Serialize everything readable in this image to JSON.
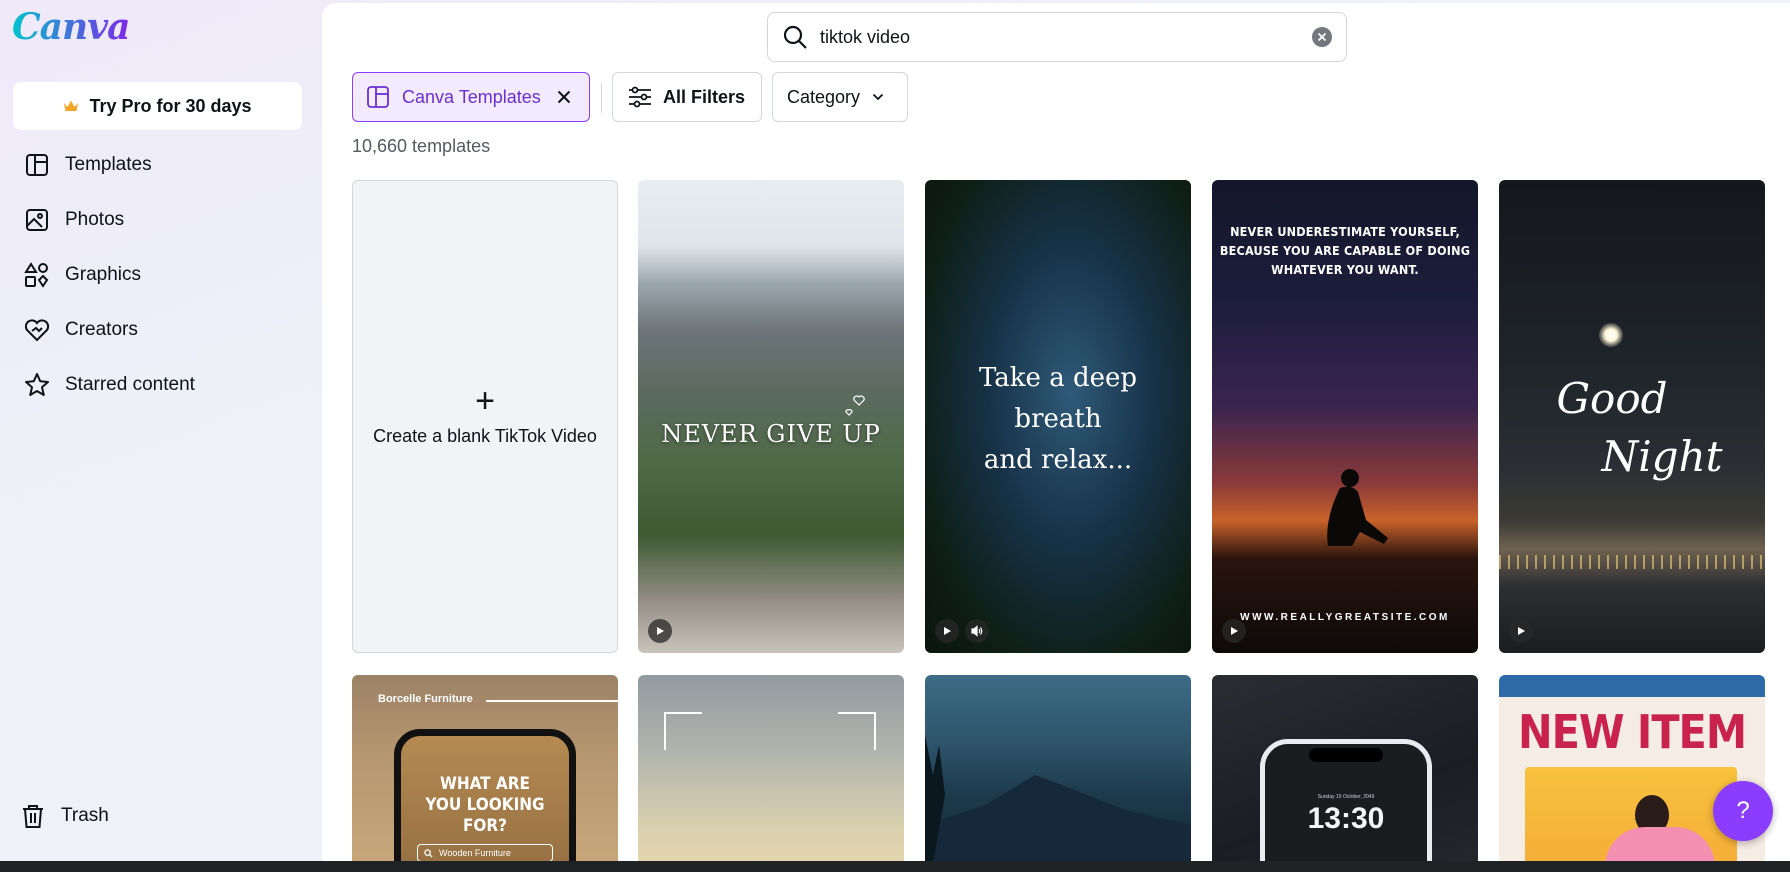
{
  "app": {
    "logo": "Canva"
  },
  "sidebar": {
    "pro_label": "Try Pro for 30 days",
    "items": [
      {
        "label": "Templates",
        "icon": "templates-icon"
      },
      {
        "label": "Photos",
        "icon": "photos-icon"
      },
      {
        "label": "Graphics",
        "icon": "graphics-icon"
      },
      {
        "label": "Creators",
        "icon": "creators-icon"
      },
      {
        "label": "Starred content",
        "icon": "star-icon"
      }
    ],
    "trash_label": "Trash"
  },
  "search": {
    "value": "tiktok video"
  },
  "filters": {
    "templates_chip": "Canva Templates",
    "all_filters": "All Filters",
    "category": "Category"
  },
  "results": {
    "count": "10,660 templates",
    "blank_label": "Create a blank TikTok Video",
    "cards": [
      {
        "text": "NEVER GIVE UP"
      },
      {
        "text_lines": [
          "Take a deep",
          "breath",
          "and relax..."
        ]
      },
      {
        "text_lines": [
          "NEVER UNDERESTIMATE YOURSELF,",
          "BECAUSE YOU ARE CAPABLE OF DOING",
          "WHATEVER YOU WANT."
        ],
        "footer": "WWW.REALLYGREATSITE.COM"
      },
      {
        "text_lines": [
          "Good",
          "Night"
        ]
      },
      {
        "brand": "Borcelle Furniture",
        "text_lines": [
          "WHAT ARE",
          "YOU LOOKING",
          "FOR?"
        ],
        "search_text": "Wooden Furniture"
      },
      {},
      {},
      {
        "date": "Sunday 15 October, 2049",
        "time": "13:30"
      },
      {
        "text": "NEW ITEM"
      }
    ]
  },
  "help": {
    "label": "?"
  },
  "colors": {
    "accent": "#8b3dff",
    "chip_bg": "#f1ebfd"
  }
}
